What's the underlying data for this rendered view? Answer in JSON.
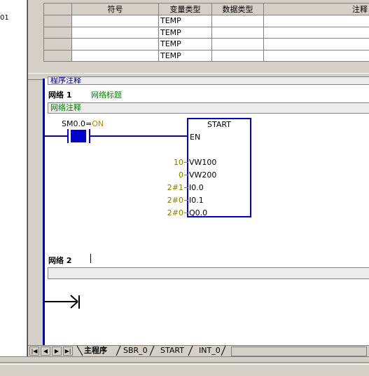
{
  "left_panel": {
    "text": "01"
  },
  "var_table": {
    "headers": [
      "",
      "符号",
      "变量类型",
      "数据类型",
      "注释"
    ],
    "rows": [
      {
        "symbol": "",
        "var_type": "TEMP",
        "data_type": "",
        "comment": ""
      },
      {
        "symbol": "",
        "var_type": "TEMP",
        "data_type": "",
        "comment": ""
      },
      {
        "symbol": "",
        "var_type": "TEMP",
        "data_type": "",
        "comment": ""
      },
      {
        "symbol": "",
        "var_type": "TEMP",
        "data_type": "",
        "comment": ""
      }
    ]
  },
  "program_comment": "程序注释",
  "network1": {
    "label": "网络 1",
    "title": "网络标题",
    "comment": "网络注释",
    "contact": {
      "address": "SM0.0",
      "eq": "=",
      "state": "ON"
    },
    "block": {
      "name": "START",
      "en": "EN",
      "pins": [
        {
          "value": "10",
          "pin": "VW100"
        },
        {
          "value": "0",
          "pin": "VW200"
        },
        {
          "value": "2#1",
          "pin": "I0.0"
        },
        {
          "value": "2#0",
          "pin": "I0.1"
        },
        {
          "value": "2#0",
          "pin": "Q0.0"
        }
      ]
    }
  },
  "network2": {
    "label": "网络 2",
    "title": ""
  },
  "tabs": {
    "items": [
      "主程序",
      "SBR_0",
      "START",
      "INT_0"
    ],
    "active": "主程序"
  },
  "colors": {
    "rung": "#0000cc",
    "comment_text": "#008000",
    "param_text": "#808000",
    "frame": "#d4d0c8"
  },
  "icons": {
    "first": "nav-first-icon",
    "prev": "nav-prev-icon",
    "next": "nav-next-icon",
    "last": "nav-last-icon",
    "cursor": "cursor-arrow-icon"
  }
}
